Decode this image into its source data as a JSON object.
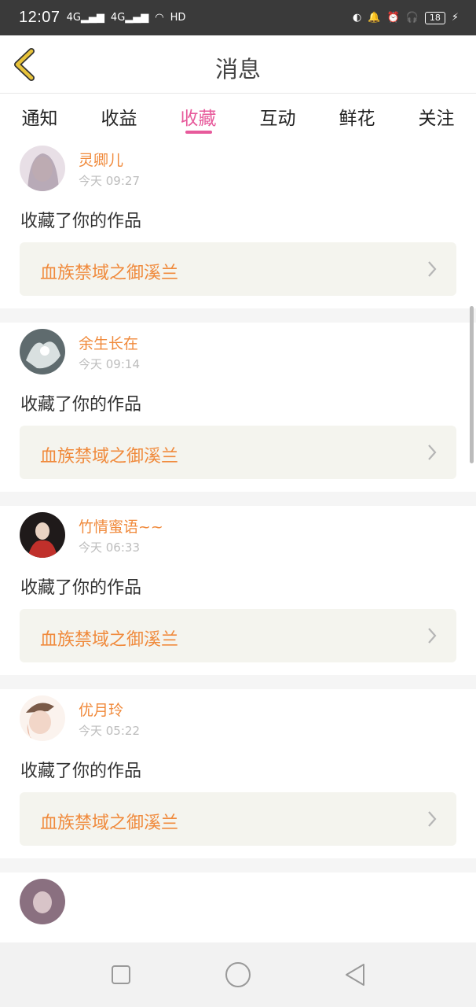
{
  "status_bar": {
    "time": "12:07",
    "network_1": "4G",
    "network_2": "4G",
    "hd_label": "HD",
    "battery": "18"
  },
  "header": {
    "title": "消息"
  },
  "tabs": [
    {
      "label": "通知",
      "active": false
    },
    {
      "label": "收益",
      "active": false
    },
    {
      "label": "收藏",
      "active": true
    },
    {
      "label": "互动",
      "active": false
    },
    {
      "label": "鲜花",
      "active": false
    },
    {
      "label": "关注",
      "active": false
    }
  ],
  "messages": [
    {
      "user": "灵卿儿",
      "time": "今天 09:27",
      "action": "收藏了你的作品",
      "work": "血族禁域之御溪兰",
      "avatar_color": "#c9b7c8"
    },
    {
      "user": "余生长在",
      "time": "今天 09:14",
      "action": "收藏了你的作品",
      "work": "血族禁域之御溪兰",
      "avatar_color": "#9aa7a8"
    },
    {
      "user": "竹情蜜语~~",
      "time": "今天 06:33",
      "action": "收藏了你的作品",
      "work": "血族禁域之御溪兰",
      "avatar_color": "#b8322f"
    },
    {
      "user": "优月玲",
      "time": "今天 05:22",
      "action": "收藏了你的作品",
      "work": "血族禁域之御溪兰",
      "avatar_color": "#e7c6b5"
    },
    {
      "user": "",
      "time": "",
      "action": "",
      "work": "",
      "avatar_color": "#8a7080"
    }
  ],
  "colors": {
    "accent_pink": "#e75a9b",
    "name_orange": "#f08a3c",
    "back_arrow": "#e8c33a"
  },
  "icons": {
    "back": "back-arrow-icon",
    "chevron": "chevron-right-icon",
    "nav_recent": "square-icon",
    "nav_home": "circle-icon",
    "nav_back": "triangle-back-icon"
  }
}
